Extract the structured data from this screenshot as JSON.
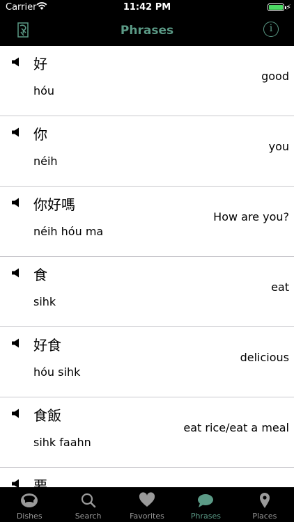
{
  "status": {
    "carrier": "Carrier",
    "time": "11:42 PM",
    "bolt": "⚡"
  },
  "nav": {
    "title": "Phrases",
    "info": "i"
  },
  "phrases": [
    {
      "hanzi": "好",
      "roman": "hóu",
      "english": "good"
    },
    {
      "hanzi": "你",
      "roman": "néih",
      "english": "you"
    },
    {
      "hanzi": "你好嗎",
      "roman": "néih hóu ma",
      "english": "How are you?"
    },
    {
      "hanzi": "食",
      "roman": "sihk",
      "english": "eat"
    },
    {
      "hanzi": "好食",
      "roman": "hóu sihk",
      "english": "delicious"
    },
    {
      "hanzi": "食飯",
      "roman": "sihk faahn",
      "english": "eat rice/eat a meal"
    },
    {
      "hanzi": "要",
      "roman": "",
      "english": ""
    }
  ],
  "tabs": [
    {
      "label": "Dishes",
      "icon": "dish-icon"
    },
    {
      "label": "Search",
      "icon": "search-icon"
    },
    {
      "label": "Favorites",
      "icon": "heart-icon"
    },
    {
      "label": "Phrases",
      "icon": "chat-bubble-icon",
      "active": true
    },
    {
      "label": "Places",
      "icon": "map-pin-icon"
    }
  ],
  "colors": {
    "accent": "#5b9a86",
    "tab_inactive": "#9a9a9a",
    "battery": "#4cd964"
  }
}
